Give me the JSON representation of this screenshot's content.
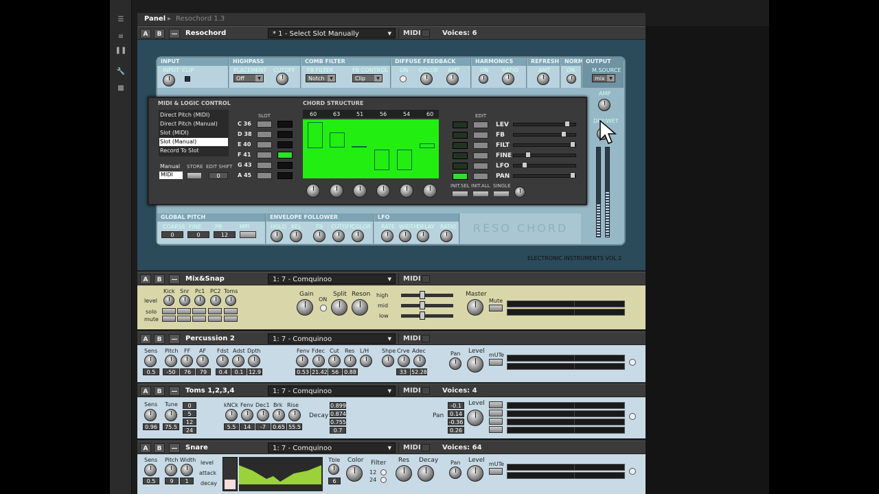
{
  "topbar": {
    "panel_tab": "Panel",
    "breadcrumb": "Resochord 1.3"
  },
  "resochord": {
    "header": {
      "a": "A",
      "b": "B",
      "dash": "—",
      "name": "Resochord",
      "preset": "* 1 - Select Slot Manually",
      "midi": "MIDI",
      "voices": "Voices: 6"
    },
    "sections": {
      "input": "INPUT",
      "input_knob": "INPUT",
      "clip": "CLIP",
      "highpass": "HIGHPASS",
      "placement": "PLACEMENT",
      "placement_value": "Off",
      "cutoff": "CUTOFF",
      "comb": "COMB FILTER",
      "fb_filter": "FB FILTER",
      "fb_filter_value": "Notch",
      "fb_control": "FB CONTROL",
      "fb_control_value": "Clip",
      "diffuse": "DIFFUSE FEEDBACK",
      "on": "ON",
      "color": "COLOR",
      "amt": "AMT",
      "harmonics": "HARMONICS",
      "ratio": "RATIO",
      "refresh": "REFRESH",
      "norm": "NORM",
      "output": "OUTPUT",
      "msource": "M.SOURCE",
      "msource_value": "mix",
      "amp": "AMP",
      "drywet": "DRY/WET"
    },
    "midi_logic": {
      "title": "MIDI & LOGIC CONTROL",
      "modes": [
        "Direct Pitch (MIDI)",
        "Direct Pitch (Manual)",
        "Slot (MIDI)",
        "Slot (Manual)",
        "Record To Slot"
      ],
      "selected": "Slot (Manual)",
      "manual": "Manual",
      "midi_value": "MIDI",
      "store": "STORE",
      "edit_shift": "EDIT SHIFT",
      "shift_value": "0",
      "slot_label": "SLOT",
      "slots": [
        "C 36",
        "D 38",
        "E 40",
        "F 41",
        "G 43",
        "A 45"
      ]
    },
    "chord": {
      "title": "CHORD STRUCTURE",
      "notes": [
        "60",
        "63",
        "51",
        "56",
        "54",
        "60"
      ],
      "edit": "EDIT",
      "rows": [
        "LEV",
        "FB",
        "FILT",
        "FINE",
        "LFO",
        "PAN"
      ],
      "init_sel": "INIT.SEL",
      "init_all": "INIT.ALL",
      "single": "SINGLE"
    },
    "bottom": {
      "global_pitch": "GLOBAL PITCH",
      "coarse": "COARSE",
      "fine": "FINE",
      "pb": "PB",
      "mpi": "MPI",
      "coarse_v": "0",
      "fine_v": "0",
      "pb_v": "12",
      "env": "ENVELOPE FOLLOWER",
      "hold": "HOLD",
      "rel": "REL",
      "fb": "FB",
      "cutoff": "CUTOFF",
      "color": "COLOR",
      "lfo": "LFO",
      "rate": "RATE",
      "width": "WIDTH",
      "delay": "DELAY",
      "ratio": "RATIO",
      "logo": "RESO CHORD"
    },
    "footer": "ELECTRONIC INSTRUMENTS VOL 2"
  },
  "mixsnap": {
    "header": {
      "a": "A",
      "b": "B",
      "dash": "—",
      "name": "Mix&Snap",
      "preset": "1: 7 - Comquinoo",
      "midi": "MIDI"
    },
    "channels": [
      "Kick",
      "Snr",
      "Pc1",
      "PC2",
      "Toms"
    ],
    "rows": [
      "level",
      "solo",
      "mute"
    ],
    "gain": "Gain",
    "on": "ON",
    "split": "Split",
    "reson": "Reson",
    "bands": [
      "high",
      "mid",
      "low"
    ],
    "master": "Master",
    "mute": "Mute"
  },
  "percussion": {
    "header": {
      "a": "A",
      "b": "B",
      "dash": "—",
      "name": "Percussion 2",
      "preset": "1: 7 - Comquinoo",
      "midi": "MIDI"
    },
    "knobs": [
      "Sens",
      "Pitch",
      "FF",
      "AF",
      "Fdst",
      "Adst",
      "Dpth",
      "Fenv",
      "Fdec",
      "Cut",
      "Res",
      "L/H",
      "Shpe",
      "Crve",
      "Adec",
      "Pan",
      "Level"
    ],
    "values": [
      "0.5",
      "-50",
      "76",
      "79",
      "0.4",
      "0.1",
      "12.9",
      "0.53",
      "21.42",
      "56",
      "0.88",
      "33",
      "52.28"
    ],
    "mute": "mUTe"
  },
  "toms": {
    "header": {
      "a": "A",
      "b": "B",
      "dash": "—",
      "name": "Toms 1,2,3,4",
      "preset": "1: 7 - Comquinoo",
      "midi": "MIDI",
      "voices": "Voices: 4"
    },
    "labels": [
      "Sens",
      "Tune",
      "kNCk",
      "Fenv",
      "Dec1",
      "Brk",
      "Rise",
      "Decay",
      "Pan",
      "Level"
    ],
    "sens_v": "0.96",
    "tune_v": "75.5",
    "tune_list": [
      "0",
      "5",
      "12",
      "24"
    ],
    "mid_vals": [
      "5.5",
      "14",
      "-7",
      "0.65",
      "55.5"
    ],
    "decay_vals": [
      "0.899",
      "0.874",
      "0.755",
      "0.7"
    ],
    "pan_vals": [
      "-0.1",
      "0.14",
      "-0.36",
      "0.26"
    ]
  },
  "snare": {
    "header": {
      "a": "A",
      "b": "B",
      "dash": "—",
      "name": "Snare",
      "preset": "1: 7 - Comquinoo",
      "midi": "MIDI",
      "voices": "Voices: 64"
    },
    "labels": [
      "Sens",
      "Pitch",
      "Width",
      "level",
      "attack",
      "decay",
      "Tble",
      "Color",
      "Filter",
      "Res",
      "Decay",
      "Pan",
      "Level",
      "mUTe"
    ],
    "sens_v": "0.5",
    "pitch_v": "9",
    "width_v": "1",
    "tble_v": "6",
    "filter_opts": [
      "12",
      "24"
    ]
  }
}
